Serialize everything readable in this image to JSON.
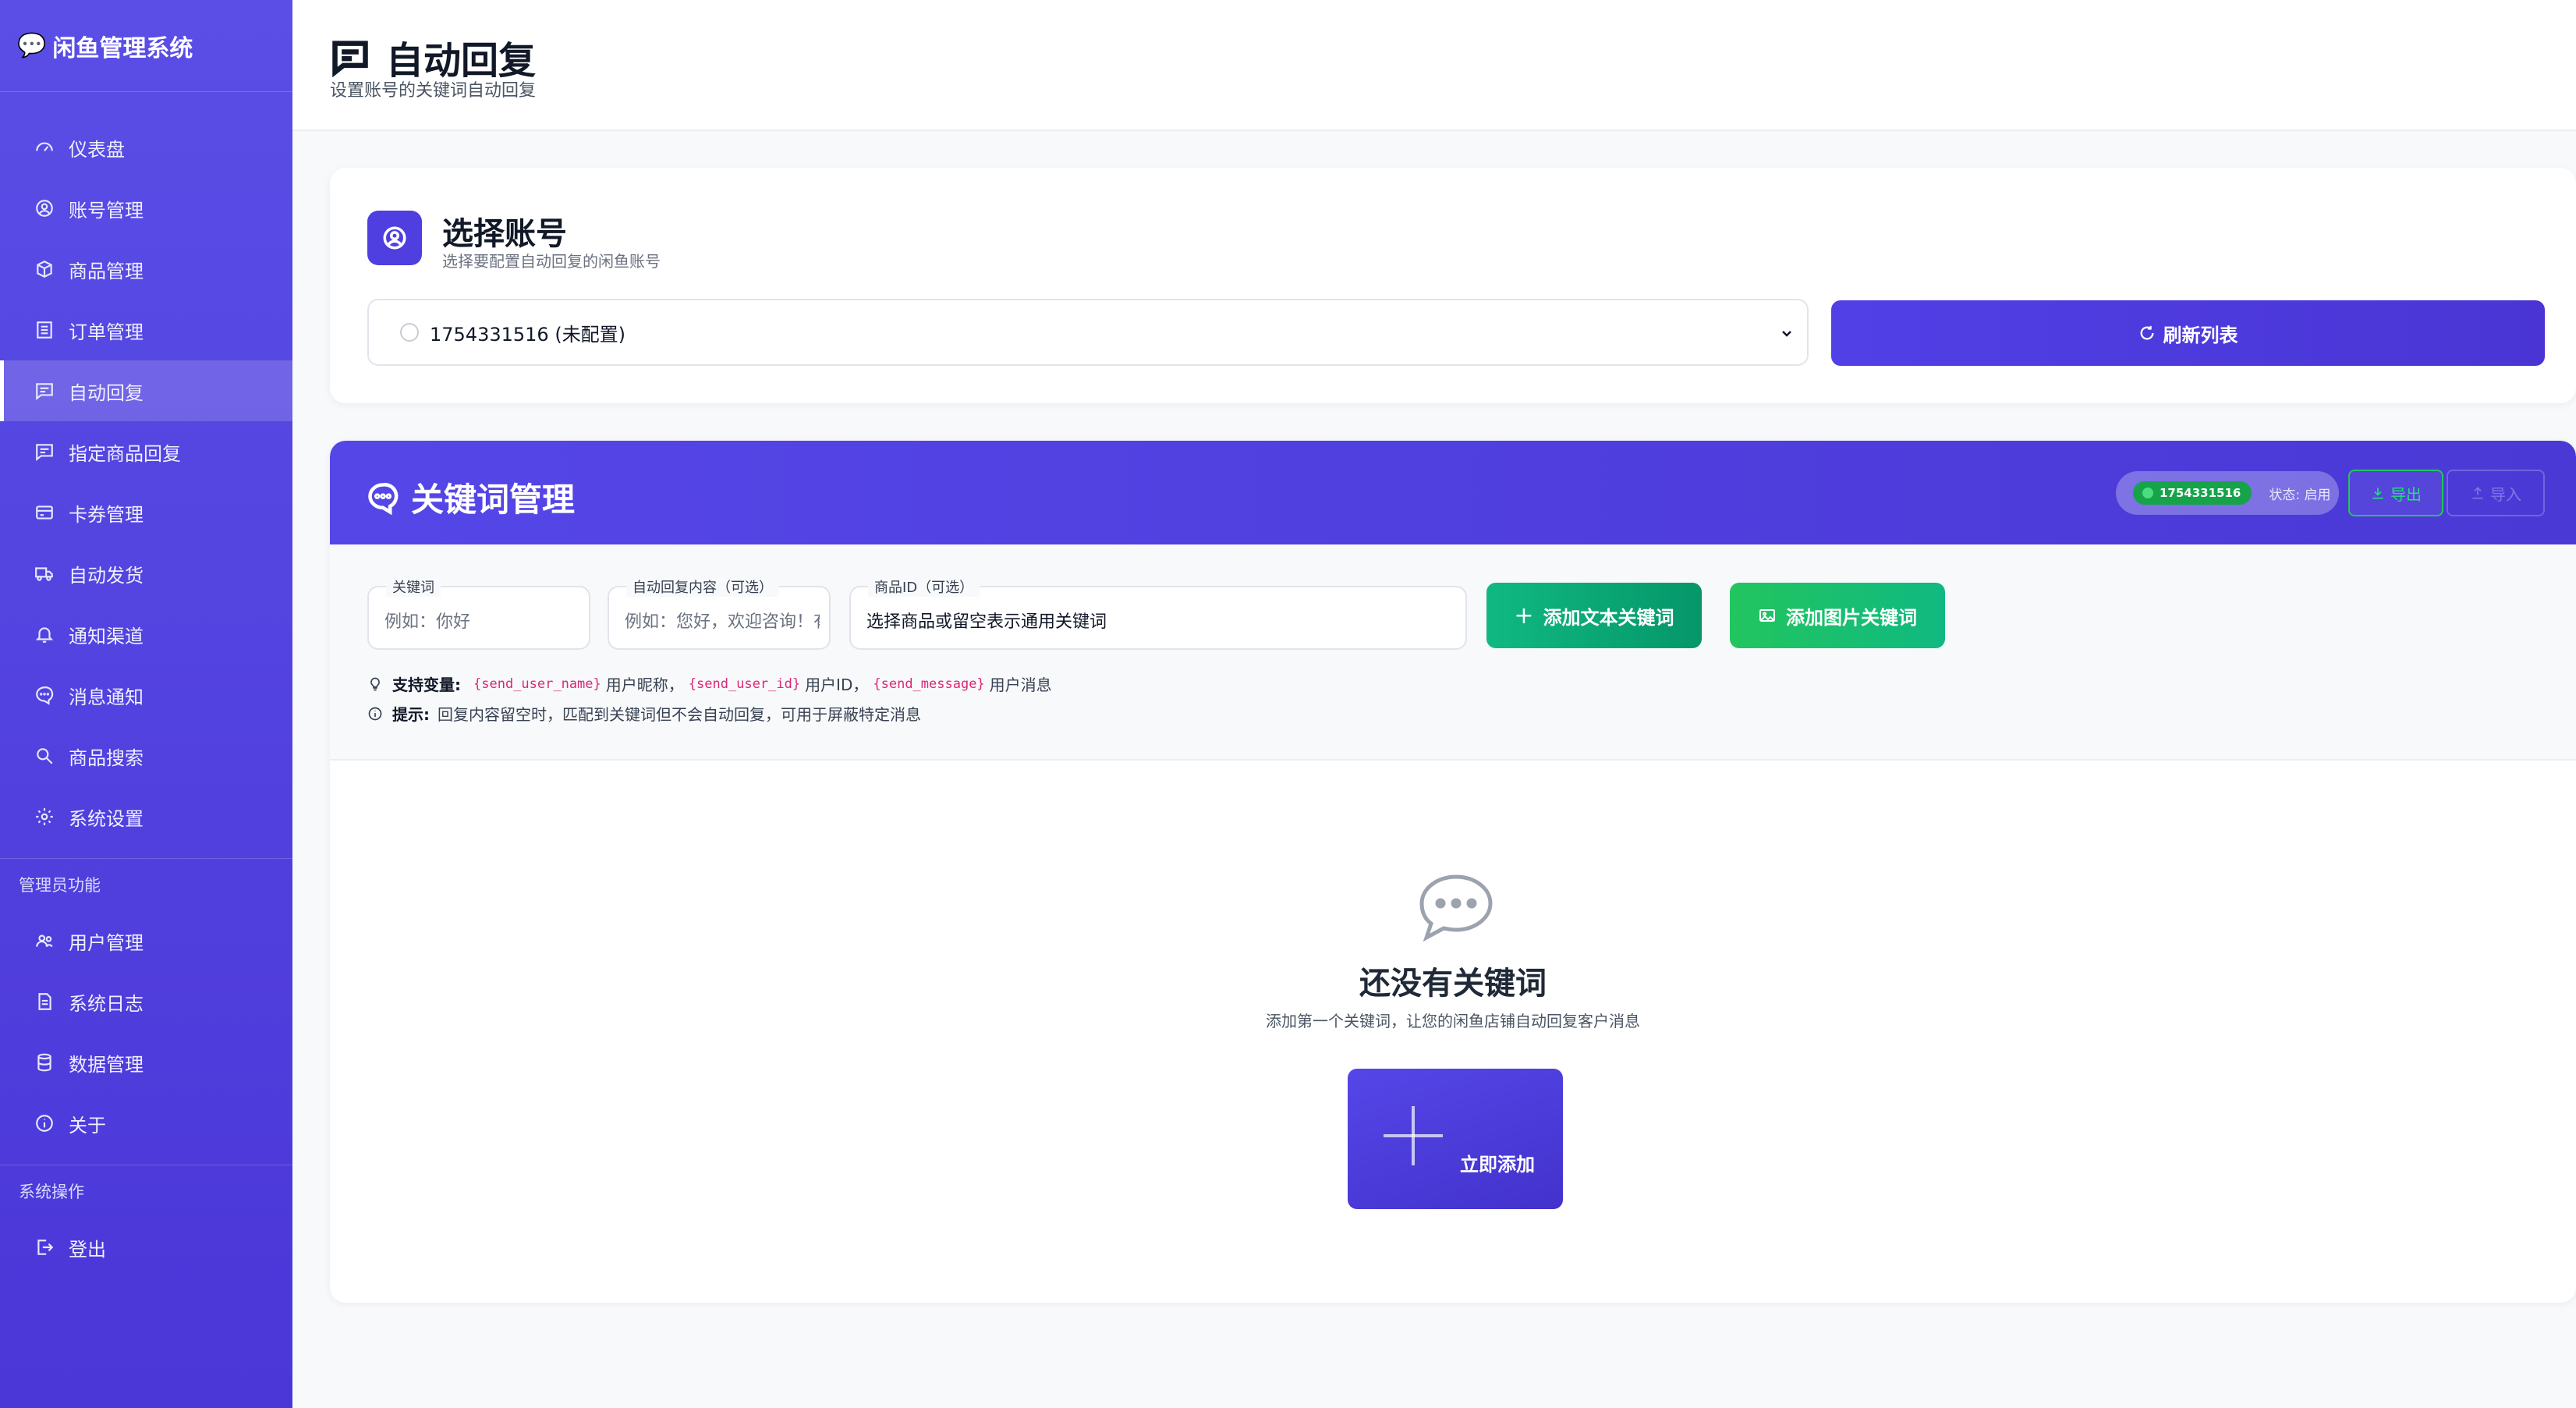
{
  "brand": {
    "title": "闲鱼管理系统"
  },
  "sidebar": {
    "items": [
      {
        "label": "仪表盘",
        "icon": "dashboard-icon"
      },
      {
        "label": "账号管理",
        "icon": "user-circle-icon"
      },
      {
        "label": "商品管理",
        "icon": "box-icon"
      },
      {
        "label": "订单管理",
        "icon": "list-icon"
      },
      {
        "label": "自动回复",
        "icon": "message-square-icon",
        "active": true
      },
      {
        "label": "指定商品回复",
        "icon": "message-square-icon"
      },
      {
        "label": "卡券管理",
        "icon": "card-icon"
      },
      {
        "label": "自动发货",
        "icon": "truck-icon"
      },
      {
        "label": "通知渠道",
        "icon": "bell-icon"
      },
      {
        "label": "消息通知",
        "icon": "chat-icon"
      },
      {
        "label": "商品搜索",
        "icon": "search-icon"
      },
      {
        "label": "系统设置",
        "icon": "gear-icon"
      }
    ],
    "admin_section": "管理员功能",
    "admin_items": [
      {
        "label": "用户管理",
        "icon": "users-icon"
      },
      {
        "label": "系统日志",
        "icon": "file-icon"
      },
      {
        "label": "数据管理",
        "icon": "database-icon"
      },
      {
        "label": "关于",
        "icon": "info-icon"
      }
    ],
    "system_section": "系统操作",
    "system_items": [
      {
        "label": "登出",
        "icon": "logout-icon"
      }
    ]
  },
  "header": {
    "title": "自动回复",
    "subtitle": "设置账号的关键词自动回复"
  },
  "account": {
    "title": "选择账号",
    "subtitle": "选择要配置自动回复的闲鱼账号",
    "selected": "1754331516 (未配置)",
    "refresh_label": "刷新列表"
  },
  "keywords": {
    "title": "关键词管理",
    "status_id": "1754331516",
    "status_text": "状态: 启用",
    "export_label": "导出",
    "import_label": "导入",
    "form": {
      "keyword_label": "关键词",
      "keyword_placeholder": "例如：你好",
      "reply_label": "自动回复内容（可选）",
      "reply_placeholder": "例如：您好，欢迎咨询！有",
      "item_label": "商品ID（可选）",
      "item_value": "选择商品或留空表示通用关键词",
      "add_text_label": "添加文本关键词",
      "add_image_label": "添加图片关键词"
    },
    "hint_vars": {
      "label": "支持变量:",
      "var1": "{send_user_name}",
      "desc1": "用户昵称，",
      "var2": "{send_user_id}",
      "desc2": "用户ID，",
      "var3": "{send_message}",
      "desc3": "用户消息"
    },
    "hint_tip": {
      "label": "提示:",
      "text": "回复内容留空时，匹配到关键词但不会自动回复，可用于屏蔽特定消息"
    },
    "empty": {
      "title": "还没有关键词",
      "subtitle": "添加第一个关键词，让您的闲鱼店铺自动回复客户消息",
      "add_now_label": "立即添加"
    }
  }
}
